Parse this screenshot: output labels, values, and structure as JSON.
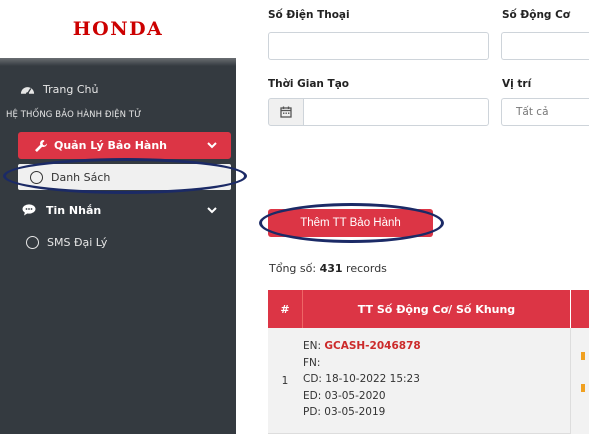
{
  "brand": {
    "logo_text": "HONDA",
    "color": "#cc0000"
  },
  "sidebar": {
    "home": {
      "icon": "dashboard-icon",
      "label": "Trang Chủ"
    },
    "section_header": "HỆ THỐNG BẢO HÀNH ĐIỆN TỬ",
    "warranty_menu": {
      "icon": "wrench-icon",
      "label": "Quản Lý Bảo Hành",
      "expanded": true
    },
    "warranty_list": {
      "icon": "circle-icon",
      "label": "Danh Sách",
      "selected": true
    },
    "messages_menu": {
      "icon": "chat-icon",
      "label": "Tin Nhắn",
      "expanded": true
    },
    "sms_dealer": {
      "icon": "circle-icon",
      "label": "SMS Đại Lý"
    }
  },
  "filters": {
    "phone_label": "Số Điện Thoại",
    "phone_value": "",
    "engine_label": "Số Động Cơ",
    "engine_value": "",
    "created_label": "Thời Gian Tạo",
    "created_value": "",
    "location_label": "Vị trí",
    "location_value": "Tất cả"
  },
  "actions": {
    "add_label": "Thêm TT Bảo Hành"
  },
  "summary": {
    "prefix": "Tổng số:",
    "count": "431",
    "suffix": "records"
  },
  "table": {
    "headers": [
      "#",
      "TT Số Động Cơ/ Số Khung"
    ],
    "rows": [
      {
        "num": "1",
        "en_label": "EN:",
        "en_value": "GCASH-2046878",
        "fn": "FN:",
        "cd": "CD: 18-10-2022 15:23",
        "ed": "ED: 03-05-2020",
        "pd": "PD: 03-05-2019"
      }
    ]
  },
  "colors": {
    "accent": "#dc3545",
    "sidebar_bg": "#343a40",
    "annotation": "#1b2a66"
  }
}
